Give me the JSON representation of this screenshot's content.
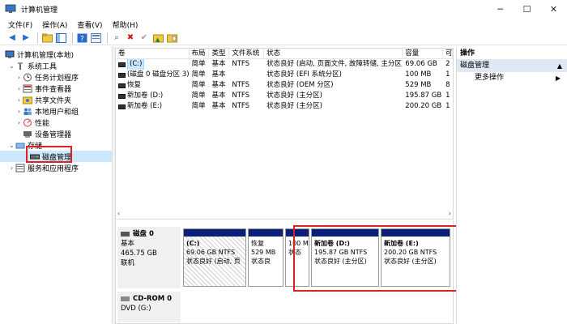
{
  "window": {
    "title": "计算机管理",
    "controls": {
      "minimize": "─",
      "maximize": "☐",
      "close": "✕"
    }
  },
  "menu": [
    "文件(F)",
    "操作(A)",
    "查看(V)",
    "帮助(H)"
  ],
  "tree": {
    "root": "计算机管理(本地)",
    "system_tools": "系统工具",
    "task_scheduler": "任务计划程序",
    "event_viewer": "事件查看器",
    "shared_folders": "共享文件夹",
    "local_users": "本地用户和组",
    "performance": "性能",
    "device_manager": "设备管理器",
    "storage": "存储",
    "disk_management": "磁盘管理",
    "services_apps": "服务和应用程序"
  },
  "volume_list": {
    "headers": [
      "卷",
      "布局",
      "类型",
      "文件系统",
      "状态",
      "容量",
      "可"
    ],
    "rows": [
      {
        "volume": "(C:)",
        "layout": "简单",
        "type": "基本",
        "fs": "NTFS",
        "status": "状态良好 (启动, 页面文件, 故障转储, 主分区)",
        "capacity": "69.06 GB",
        "free": "2"
      },
      {
        "volume": "(磁盘 0 磁盘分区 3)",
        "layout": "简单",
        "type": "基本",
        "fs": "",
        "status": "状态良好 (EFI 系统分区)",
        "capacity": "100 MB",
        "free": "1"
      },
      {
        "volume": "恢复",
        "layout": "简单",
        "type": "基本",
        "fs": "NTFS",
        "status": "状态良好 (OEM 分区)",
        "capacity": "529 MB",
        "free": "8"
      },
      {
        "volume": "新加卷 (D:)",
        "layout": "简单",
        "type": "基本",
        "fs": "NTFS",
        "status": "状态良好 (主分区)",
        "capacity": "195.87 GB",
        "free": "1"
      },
      {
        "volume": "新加卷 (E:)",
        "layout": "简单",
        "type": "基本",
        "fs": "NTFS",
        "status": "状态良好 (主分区)",
        "capacity": "200.20 GB",
        "free": "1"
      }
    ]
  },
  "disk0": {
    "name": "磁盘 0",
    "type": "基本",
    "size": "465.75 GB",
    "state": "联机",
    "partitions": [
      {
        "name": "(C:)",
        "size": "69.06 GB NTFS",
        "status": "状态良好 (启动, 页"
      },
      {
        "name": "恢复",
        "size": "529 MB",
        "status": "状态良"
      },
      {
        "name": "",
        "size": "100 M",
        "status": "状态"
      },
      {
        "name": "新加卷 (D:)",
        "size": "195.87 GB NTFS",
        "status": "状态良好 (主分区)"
      },
      {
        "name": "新加卷 (E:)",
        "size": "200.20 GB NTFS",
        "status": "状态良好 (主分区)"
      }
    ]
  },
  "cdrom": {
    "name": "CD-ROM 0",
    "drive": "DVD (G:)"
  },
  "actions": {
    "header": "操作",
    "section": "磁盘管理",
    "more": "更多操作"
  },
  "colors": {
    "partition_band": "#0a1f78",
    "highlight_box": "#e02020",
    "selection": "#cce8ff"
  }
}
